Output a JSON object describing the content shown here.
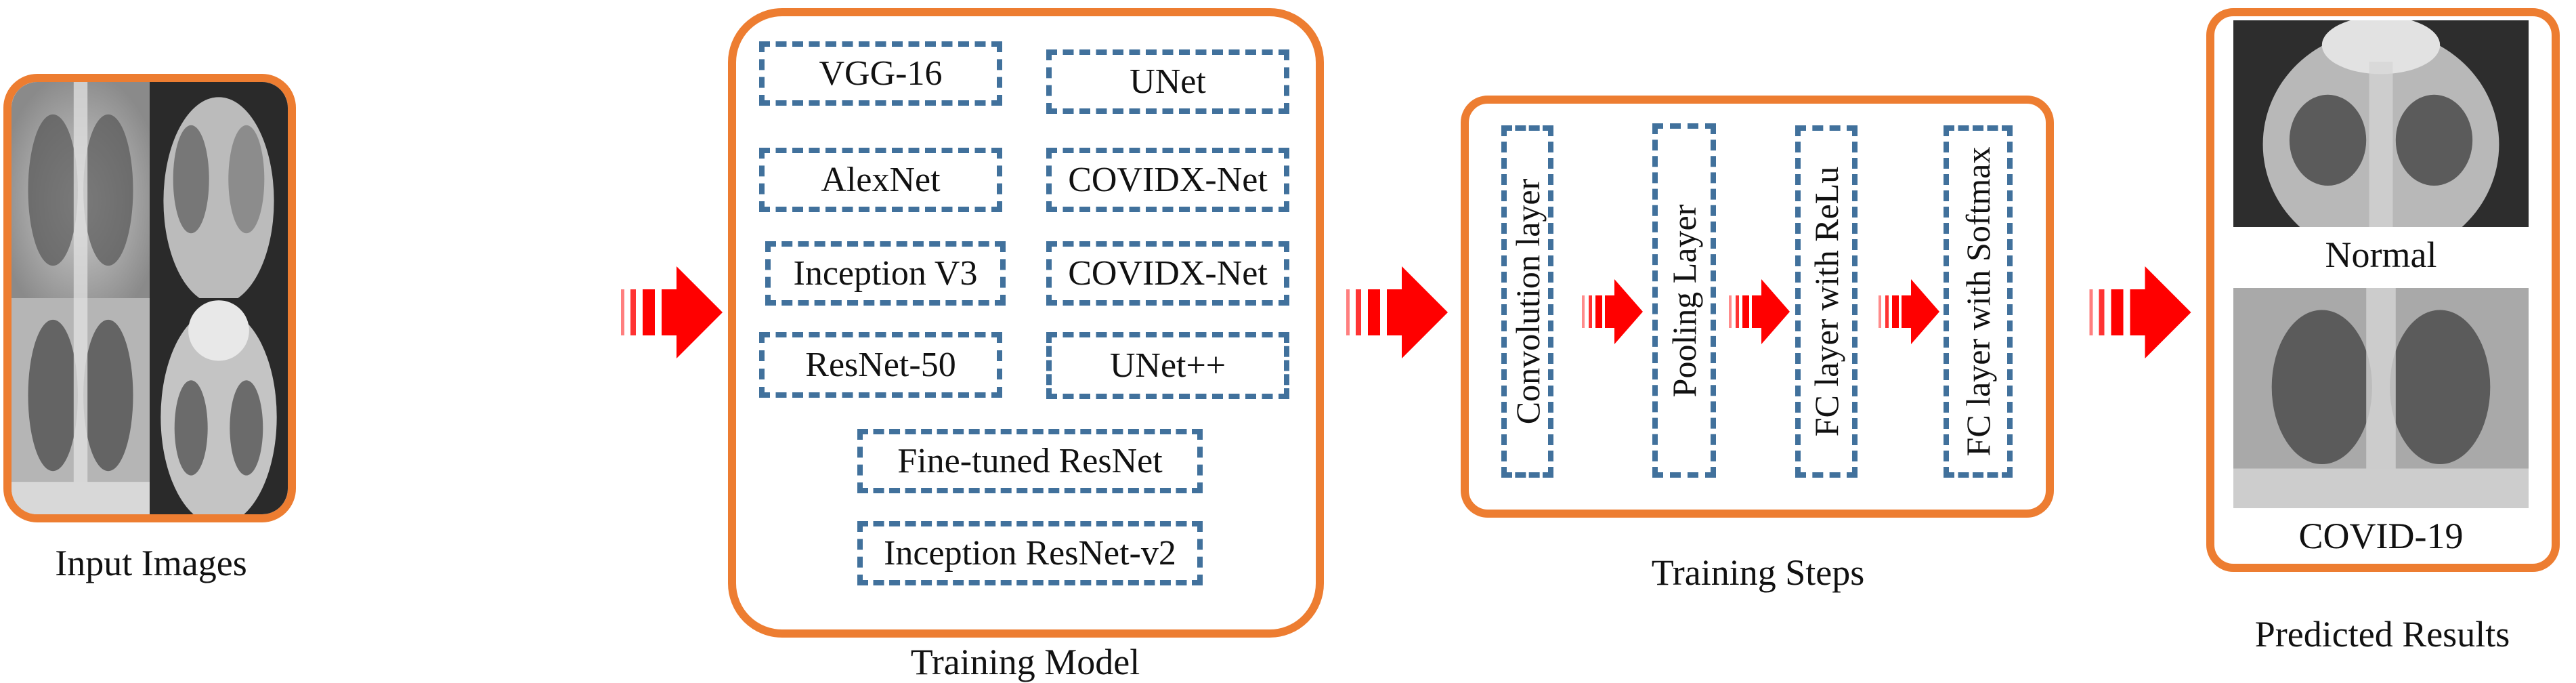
{
  "stages": {
    "input": {
      "caption": "Input Images",
      "image_count": 4
    },
    "training_model": {
      "caption": "Training Model",
      "models": [
        "VGG-16",
        "UNet",
        "AlexNet",
        "COVIDX-Net",
        "Inception V3",
        "COVIDX-Net",
        "ResNet-50",
        "UNet++",
        "Fine-tuned ResNet",
        "Inception ResNet-v2"
      ]
    },
    "training_steps": {
      "caption": "Training Steps",
      "steps": [
        "Convolution layer",
        "Pooling Layer",
        "FC layer with ReLu",
        "FC layer with Softmax"
      ]
    },
    "predicted": {
      "caption": "Predicted Results",
      "classes": [
        "Normal",
        "COVID-19"
      ]
    }
  },
  "colors": {
    "panel_border": "#ED7D31",
    "dashed_box": "#41719C",
    "arrow": "#FF0000"
  }
}
